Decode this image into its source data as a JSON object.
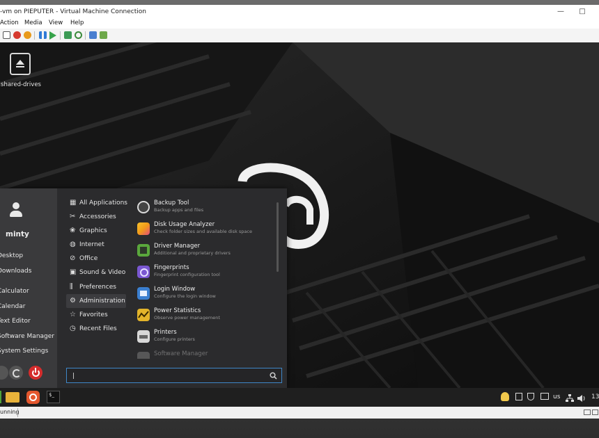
{
  "window": {
    "title": "-vm on PIEPUTER - Virtual Machine Connection",
    "minimize_glyph": "—",
    "maximize_glyph": "□"
  },
  "menubar": [
    "Action",
    "Media",
    "View",
    "Help"
  ],
  "toolbar_icons": [
    "ctrl-alt-del-icon",
    "stop-icon",
    "shutdown-icon",
    "power-icon",
    "pause-icon",
    "start-icon",
    "checkpoint-icon",
    "revert-icon",
    "enhanced-session-icon",
    "share-icon"
  ],
  "desktop": {
    "icon_label": "shared-drives"
  },
  "start_menu": {
    "user_name": "minty",
    "favorites": [
      "Desktop",
      "Downloads",
      "Calculator",
      "Calendar",
      "Text Editor",
      "Software Manager",
      "System Settings"
    ],
    "categories": [
      {
        "label": "All Applications",
        "icon": "grid-icon"
      },
      {
        "label": "Accessories",
        "icon": "tools-icon"
      },
      {
        "label": "Graphics",
        "icon": "palette-icon"
      },
      {
        "label": "Internet",
        "icon": "globe-icon"
      },
      {
        "label": "Office",
        "icon": "clip-icon"
      },
      {
        "label": "Sound & Video",
        "icon": "film-icon"
      },
      {
        "label": "Preferences",
        "icon": "sliders-icon"
      },
      {
        "label": "Administration",
        "icon": "gear-icon",
        "selected": true
      },
      {
        "label": "Favorites",
        "icon": "star-icon"
      },
      {
        "label": "Recent Files",
        "icon": "clock-icon"
      }
    ],
    "apps": [
      {
        "name": "Backup Tool",
        "desc": "Backup apps and files",
        "color": "#dadada"
      },
      {
        "name": "Disk Usage Analyzer",
        "desc": "Check folder sizes and available disk space",
        "color": "#f29b1a"
      },
      {
        "name": "Driver Manager",
        "desc": "Additional and proprietary drivers",
        "color": "#5aa83c"
      },
      {
        "name": "Fingerprints",
        "desc": "Fingerprint configuration tool",
        "color": "#7a57d1"
      },
      {
        "name": "Login Window",
        "desc": "Configure the login window",
        "color": "#3b7fd0"
      },
      {
        "name": "Power Statistics",
        "desc": "Observe power management",
        "color": "#e3b42a"
      },
      {
        "name": "Printers",
        "desc": "Configure printers",
        "color": "#d8d8d8"
      },
      {
        "name": "Software Manager",
        "desc": "",
        "color": "#aaaaaa"
      }
    ],
    "search": {
      "value": "|"
    }
  },
  "panel": {
    "tray_keyboard": "us",
    "tray_clock": "13"
  },
  "statusbar": {
    "text": "unning"
  }
}
